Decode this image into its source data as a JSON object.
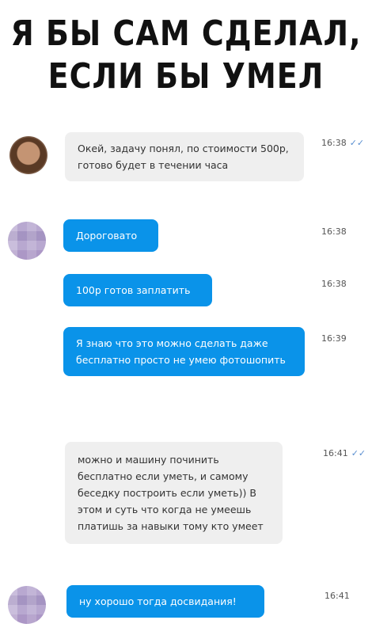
{
  "title": {
    "line1": "Я бы сам сделал,",
    "line2": "если бы умел"
  },
  "colors": {
    "outgoing_bubble": "#0a93e9",
    "incoming_bubble": "#efefef",
    "read_check": "#5a8fd0"
  },
  "messages": [
    {
      "text": "Окей, задачу понял, по стоимости 500р, готово будет в течении часа",
      "time": "16:38",
      "status": "✓✓"
    },
    {
      "text": "Дороговато",
      "time": "16:38"
    },
    {
      "text": "100р готов заплатить",
      "time": "16:38"
    },
    {
      "text": "Я знаю что это можно сделать даже бесплатно просто не умею фотошопить",
      "time": "16:39"
    },
    {
      "text": "можно и машину починить бесплатно если уметь, и самому беседку построить если уметь)) В этом и суть что когда не умеешь платишь за навыки тому кто умеет",
      "time": "16:41",
      "status": "✓✓"
    },
    {
      "text": "ну хорошо тогда досвидания!",
      "time": "16:41"
    }
  ]
}
